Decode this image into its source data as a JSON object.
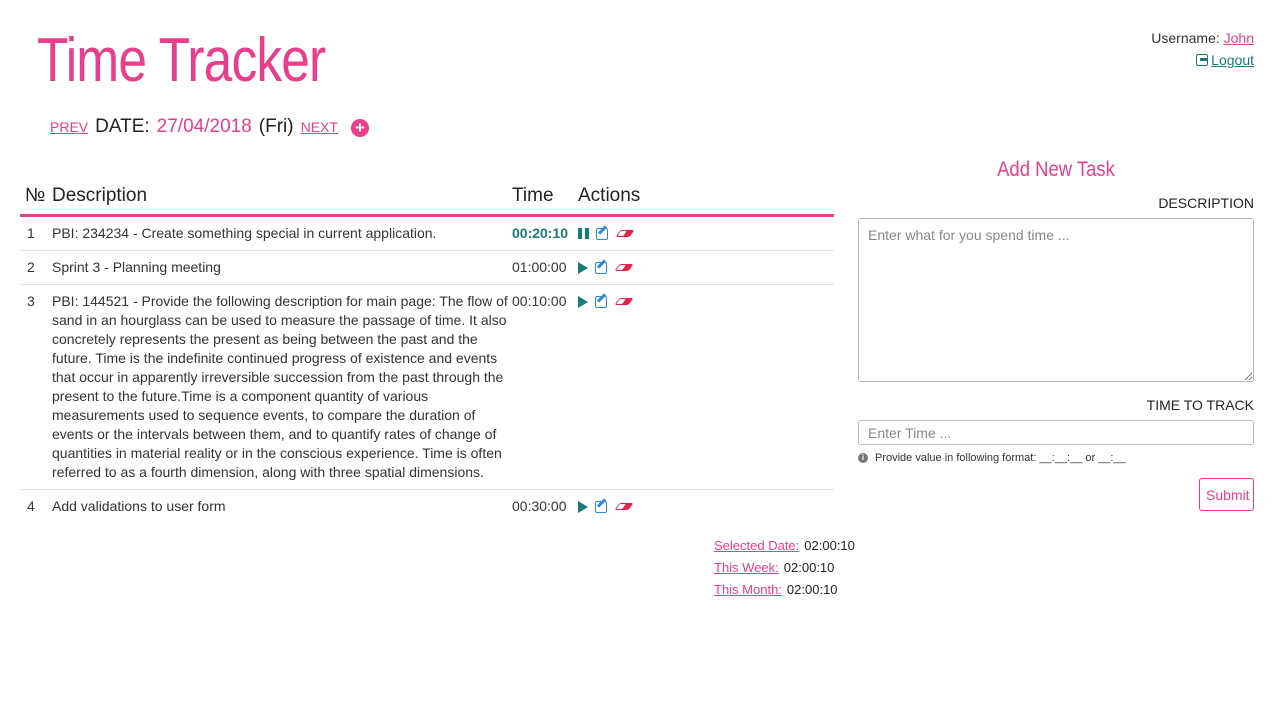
{
  "header": {
    "title": "Time Tracker",
    "prev_label": "PREV",
    "date_label": "DATE:",
    "date_value": "27/04/2018",
    "day_label": "(Fri)",
    "next_label": "NEXT",
    "add_icon": "plus-circle-icon"
  },
  "user": {
    "username_label": "Username:",
    "username": "John",
    "logout_label": "Logout"
  },
  "table": {
    "columns": [
      "№",
      "Description",
      "Time",
      "Actions"
    ],
    "rows": [
      {
        "no": "1",
        "description": "PBI: 234234 - Create something special in current application.",
        "time": "00:20:10",
        "active": true
      },
      {
        "no": "2",
        "description": "Sprint 3 - Planning meeting",
        "time": "01:00:00",
        "active": false
      },
      {
        "no": "3",
        "description": "PBI: 144521 - Provide the following description for main page: The flow of sand in an hourglass can be used to measure the passage of time. It also concretely represents the present as being between the past and the future. Time is the indefinite continued progress of existence and events that occur in apparently irreversible succession from the past through the present to the future.Time is a component quantity of various measurements used to sequence events, to compare the duration of events or the intervals between them, and to quantify rates of change of quantities in material reality or in the conscious experience. Time is often referred to as a fourth dimension, along with three spatial dimensions.",
        "time": "00:10:00",
        "active": false
      },
      {
        "no": "4",
        "description": "Add validations to user form",
        "time": "00:30:00",
        "active": false
      }
    ]
  },
  "totals": {
    "selected_date_label": "Selected Date:",
    "selected_date_value": "02:00:10",
    "week_label": "This Week:",
    "week_value": "02:00:10",
    "month_label": "This Month:",
    "month_value": "02:00:10"
  },
  "form": {
    "title": "Add New Task",
    "description_label": "DESCRIPTION",
    "description_placeholder": "Enter what for you spend time ...",
    "time_label": "TIME TO TRACK",
    "time_placeholder": "Enter Time ...",
    "hint": "Provide value in following format: __:__:__ or __:__",
    "submit_label": "Submit"
  },
  "colors": {
    "accent": "#e83e8c",
    "teal": "#1a7a7a",
    "edit": "#2a8bd8",
    "delete": "#e8224a"
  }
}
